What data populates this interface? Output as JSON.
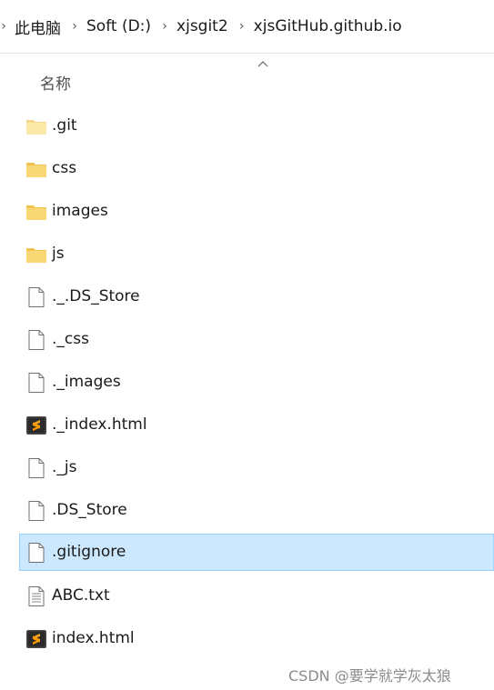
{
  "breadcrumb": {
    "items": [
      "此电脑",
      "Soft (D:)",
      "xjsgit2",
      "xjsGitHub.github.io"
    ]
  },
  "column_header": {
    "name_label": "名称",
    "sort": "ascending"
  },
  "files": [
    {
      "name": ".git",
      "icon": "folder-icon-light"
    },
    {
      "name": "css",
      "icon": "folder-icon"
    },
    {
      "name": "images",
      "icon": "folder-icon"
    },
    {
      "name": "js",
      "icon": "folder-icon"
    },
    {
      "name": "._.DS_Store",
      "icon": "file-icon"
    },
    {
      "name": "._css",
      "icon": "file-icon"
    },
    {
      "name": "._images",
      "icon": "file-icon"
    },
    {
      "name": "._index.html",
      "icon": "sublime-file-icon"
    },
    {
      "name": "._js",
      "icon": "file-icon"
    },
    {
      "name": ".DS_Store",
      "icon": "file-icon"
    },
    {
      "name": ".gitignore",
      "icon": "file-icon",
      "selected": true
    },
    {
      "name": "ABC.txt",
      "icon": "text-file-icon"
    },
    {
      "name": "index.html",
      "icon": "sublime-file-icon"
    }
  ],
  "colors": {
    "selection_bg": "#cce8ff",
    "selection_border": "#99d1ff",
    "folder": "#f8d775",
    "folder_light": "#fbe9a9"
  },
  "watermark": "CSDN @要学就学灰太狼"
}
